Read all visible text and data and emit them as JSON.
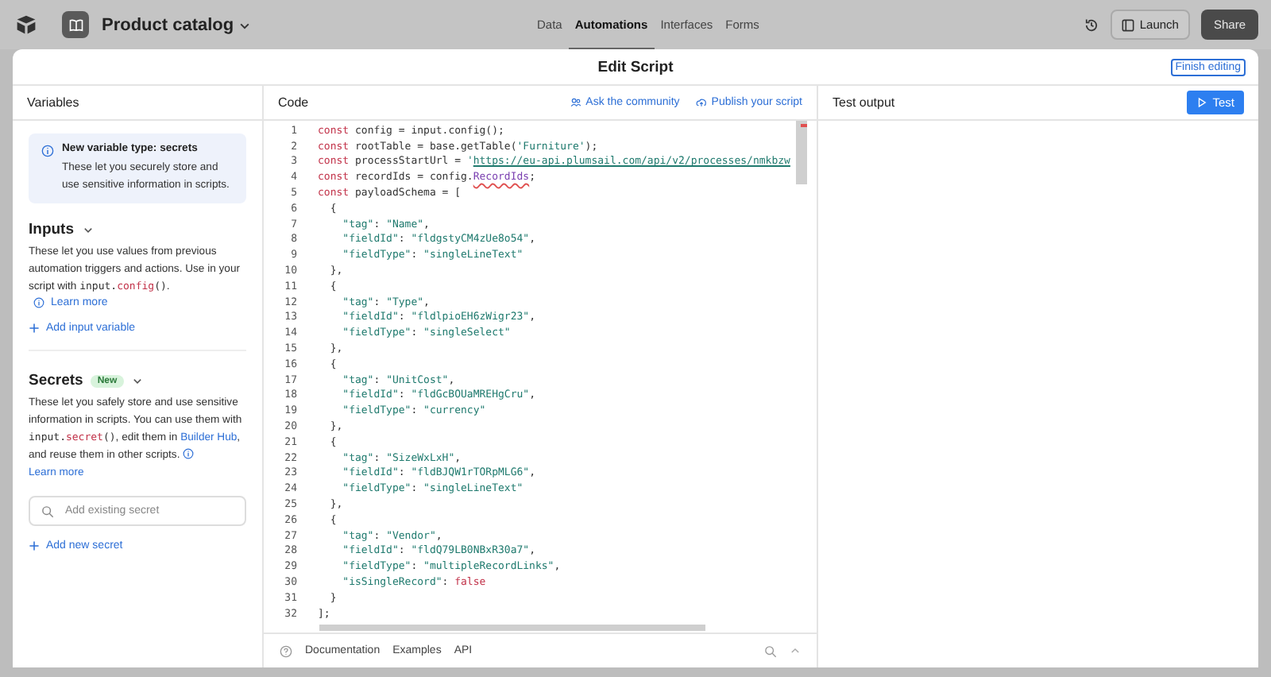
{
  "app_bar": {
    "base_name": "Product catalog",
    "nav": [
      {
        "label": "Data",
        "selected": false
      },
      {
        "label": "Automations",
        "selected": true
      },
      {
        "label": "Interfaces",
        "selected": false
      },
      {
        "label": "Forms",
        "selected": false
      }
    ],
    "launch": "Launch",
    "share": "Share"
  },
  "dialog": {
    "title": "Edit Script",
    "finish": "Finish editing"
  },
  "variables": {
    "heading": "Variables",
    "notice": {
      "title": "New variable type: secrets",
      "body": "These let you securely store and use sensitive information in scripts."
    },
    "inputs": {
      "heading": "Inputs",
      "description": [
        {
          "kind": "text",
          "text": "These let you use values from previous automation triggers and actions. Use in your script with "
        },
        {
          "kind": "code",
          "text": "input."
        },
        {
          "kind": "call",
          "text": "config"
        },
        {
          "kind": "code",
          "text": "()"
        },
        {
          "kind": "text",
          "text": "."
        }
      ],
      "learn_more": "Learn more",
      "add": "Add input variable"
    },
    "secrets": {
      "heading": "Secrets",
      "badge": "New",
      "description": [
        {
          "kind": "text",
          "text": "These let you safely store and use sensitive information in scripts. You can use them with "
        },
        {
          "kind": "code",
          "text": "input."
        },
        {
          "kind": "call",
          "text": "secret"
        },
        {
          "kind": "code",
          "text": "()"
        },
        {
          "kind": "text",
          "text": ", edit them in "
        },
        {
          "kind": "link",
          "text": "Builder Hub"
        },
        {
          "kind": "text",
          "text": ", and reuse them in other scripts. "
        },
        {
          "kind": "learn",
          "text": "Learn more"
        }
      ],
      "search_placeholder": "Add existing secret",
      "add": "Add new secret"
    }
  },
  "code": {
    "heading": "Code",
    "links": [
      "Ask the community",
      "Publish your script"
    ],
    "lines": [
      {
        "n": "1",
        "tokens": [
          {
            "kind": "kw",
            "text": "const"
          },
          {
            "kind": "pl",
            "text": " config = input.config();"
          }
        ]
      },
      {
        "n": "2",
        "tokens": [
          {
            "kind": "kw",
            "text": "const"
          },
          {
            "kind": "pl",
            "text": " rootTable = base.getTable("
          },
          {
            "kind": "str",
            "text": "'Furniture'"
          },
          {
            "kind": "pl",
            "text": ");"
          }
        ]
      },
      {
        "n": "3",
        "tokens": [
          {
            "kind": "kw",
            "text": "const"
          },
          {
            "kind": "pl",
            "text": " processStartUrl = "
          },
          {
            "kind": "str",
            "text": "'"
          },
          {
            "kind": "url",
            "text": "https://eu-api.plumsail.com/api/v2/processes/nmkbzw"
          }
        ]
      },
      {
        "n": "4",
        "tokens": [
          {
            "kind": "kw",
            "text": "const"
          },
          {
            "kind": "pl",
            "text": " recordIds = config."
          },
          {
            "kind": "err",
            "text": "RecordIds"
          },
          {
            "kind": "pl",
            "text": ";"
          }
        ]
      },
      {
        "n": "5",
        "tokens": [
          {
            "kind": "kw",
            "text": "const"
          },
          {
            "kind": "pl",
            "text": " payloadSchema = ["
          }
        ]
      },
      {
        "n": "6",
        "tokens": [
          {
            "kind": "pl",
            "text": "  {"
          }
        ]
      },
      {
        "n": "7",
        "tokens": [
          {
            "kind": "str",
            "text": "    \"tag\""
          },
          {
            "kind": "pl",
            "text": ": "
          },
          {
            "kind": "str",
            "text": "\"Name\""
          },
          {
            "kind": "pl",
            "text": ","
          }
        ]
      },
      {
        "n": "8",
        "tokens": [
          {
            "kind": "str",
            "text": "    \"fieldId\""
          },
          {
            "kind": "pl",
            "text": ": "
          },
          {
            "kind": "str",
            "text": "\"fldgstyCM4zUe8o54\""
          },
          {
            "kind": "pl",
            "text": ","
          }
        ]
      },
      {
        "n": "9",
        "tokens": [
          {
            "kind": "str",
            "text": "    \"fieldType\""
          },
          {
            "kind": "pl",
            "text": ": "
          },
          {
            "kind": "str",
            "text": "\"singleLineText\""
          }
        ]
      },
      {
        "n": "10",
        "tokens": [
          {
            "kind": "pl",
            "text": "  },"
          }
        ]
      },
      {
        "n": "11",
        "tokens": [
          {
            "kind": "pl",
            "text": "  {"
          }
        ]
      },
      {
        "n": "12",
        "tokens": [
          {
            "kind": "str",
            "text": "    \"tag\""
          },
          {
            "kind": "pl",
            "text": ": "
          },
          {
            "kind": "str",
            "text": "\"Type\""
          },
          {
            "kind": "pl",
            "text": ","
          }
        ]
      },
      {
        "n": "13",
        "tokens": [
          {
            "kind": "str",
            "text": "    \"fieldId\""
          },
          {
            "kind": "pl",
            "text": ": "
          },
          {
            "kind": "str",
            "text": "\"fldlpioEH6zWigr23\""
          },
          {
            "kind": "pl",
            "text": ","
          }
        ]
      },
      {
        "n": "14",
        "tokens": [
          {
            "kind": "str",
            "text": "    \"fieldType\""
          },
          {
            "kind": "pl",
            "text": ": "
          },
          {
            "kind": "str",
            "text": "\"singleSelect\""
          }
        ]
      },
      {
        "n": "15",
        "tokens": [
          {
            "kind": "pl",
            "text": "  },"
          }
        ]
      },
      {
        "n": "16",
        "tokens": [
          {
            "kind": "pl",
            "text": "  {"
          }
        ]
      },
      {
        "n": "17",
        "tokens": [
          {
            "kind": "str",
            "text": "    \"tag\""
          },
          {
            "kind": "pl",
            "text": ": "
          },
          {
            "kind": "str",
            "text": "\"UnitCost\""
          },
          {
            "kind": "pl",
            "text": ","
          }
        ]
      },
      {
        "n": "18",
        "tokens": [
          {
            "kind": "str",
            "text": "    \"fieldId\""
          },
          {
            "kind": "pl",
            "text": ": "
          },
          {
            "kind": "str",
            "text": "\"fldGcBOUaMREHgCru\""
          },
          {
            "kind": "pl",
            "text": ","
          }
        ]
      },
      {
        "n": "19",
        "tokens": [
          {
            "kind": "str",
            "text": "    \"fieldType\""
          },
          {
            "kind": "pl",
            "text": ": "
          },
          {
            "kind": "str",
            "text": "\"currency\""
          }
        ]
      },
      {
        "n": "20",
        "tokens": [
          {
            "kind": "pl",
            "text": "  },"
          }
        ]
      },
      {
        "n": "21",
        "tokens": [
          {
            "kind": "pl",
            "text": "  {"
          }
        ]
      },
      {
        "n": "22",
        "tokens": [
          {
            "kind": "str",
            "text": "    \"tag\""
          },
          {
            "kind": "pl",
            "text": ": "
          },
          {
            "kind": "str",
            "text": "\"SizeWxLxH\""
          },
          {
            "kind": "pl",
            "text": ","
          }
        ]
      },
      {
        "n": "23",
        "tokens": [
          {
            "kind": "str",
            "text": "    \"fieldId\""
          },
          {
            "kind": "pl",
            "text": ": "
          },
          {
            "kind": "str",
            "text": "\"fldBJQW1rTORpMLG6\""
          },
          {
            "kind": "pl",
            "text": ","
          }
        ]
      },
      {
        "n": "24",
        "tokens": [
          {
            "kind": "str",
            "text": "    \"fieldType\""
          },
          {
            "kind": "pl",
            "text": ": "
          },
          {
            "kind": "str",
            "text": "\"singleLineText\""
          }
        ]
      },
      {
        "n": "25",
        "tokens": [
          {
            "kind": "pl",
            "text": "  },"
          }
        ]
      },
      {
        "n": "26",
        "tokens": [
          {
            "kind": "pl",
            "text": "  {"
          }
        ]
      },
      {
        "n": "27",
        "tokens": [
          {
            "kind": "str",
            "text": "    \"tag\""
          },
          {
            "kind": "pl",
            "text": ": "
          },
          {
            "kind": "str",
            "text": "\"Vendor\""
          },
          {
            "kind": "pl",
            "text": ","
          }
        ]
      },
      {
        "n": "28",
        "tokens": [
          {
            "kind": "str",
            "text": "    \"fieldId\""
          },
          {
            "kind": "pl",
            "text": ": "
          },
          {
            "kind": "str",
            "text": "\"fldQ79LB0NBxR30a7\""
          },
          {
            "kind": "pl",
            "text": ","
          }
        ]
      },
      {
        "n": "29",
        "tokens": [
          {
            "kind": "str",
            "text": "    \"fieldType\""
          },
          {
            "kind": "pl",
            "text": ": "
          },
          {
            "kind": "str",
            "text": "\"multipleRecordLinks\""
          },
          {
            "kind": "pl",
            "text": ","
          }
        ]
      },
      {
        "n": "30",
        "tokens": [
          {
            "kind": "str",
            "text": "    \"isSingleRecord\""
          },
          {
            "kind": "pl",
            "text": ": "
          },
          {
            "kind": "kw",
            "text": "false"
          }
        ]
      },
      {
        "n": "31",
        "tokens": [
          {
            "kind": "pl",
            "text": "  }"
          }
        ]
      },
      {
        "n": "32",
        "tokens": [
          {
            "kind": "pl",
            "text": "];"
          }
        ]
      }
    ],
    "footer_tabs": [
      "Documentation",
      "Examples",
      "API"
    ]
  },
  "test_output": {
    "heading": "Test output",
    "button": "Test"
  }
}
